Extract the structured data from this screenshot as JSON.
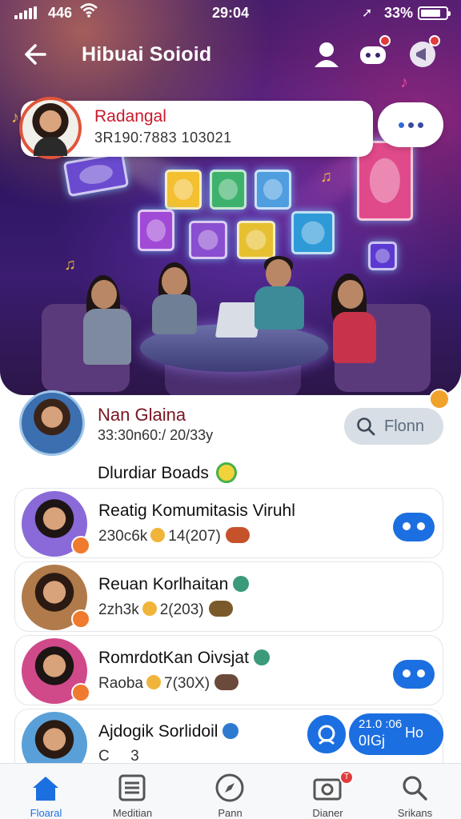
{
  "status_bar": {
    "network": "446",
    "time": "29:04",
    "battery_percent": "33%",
    "battery_level": 0.8
  },
  "header": {
    "title": "Hibuai Soioid",
    "icons": [
      "back-arrow-icon",
      "profile-icon",
      "chat-icon",
      "megaphone-icon"
    ]
  },
  "profile": {
    "name": "Radangal",
    "subtitle": "3R190:7883 103021"
  },
  "host": {
    "name": "Nan Glaina",
    "meta": "33:30n60:/ 20/33y",
    "join_label": "Flonn"
  },
  "section": {
    "title": "Dlurdiar Boads"
  },
  "items": [
    {
      "title": "Reatig Komumitasis Viruhl",
      "meta_left": "230c6k",
      "meta_right": "14(207)"
    },
    {
      "title": "Reuan Korlhaitan",
      "meta_left": "2zh3k",
      "meta_right": "2(203)"
    },
    {
      "title": "RomrdotKan Oivsjat",
      "meta_left": "Raoba",
      "meta_right": "7(30X)"
    },
    {
      "title": "Ajdogik Sorlidoil",
      "meta_left": "C",
      "meta_right": "3"
    }
  ],
  "floating": {
    "timer_line1": "21.0 :06",
    "timer_line2": "0IGj",
    "timer_line3": "Ho"
  },
  "bottom_nav": [
    {
      "label": "Floaral",
      "icon": "home-icon",
      "active": true
    },
    {
      "label": "Meditian",
      "icon": "list-icon",
      "active": false
    },
    {
      "label": "Pann",
      "icon": "compass-icon",
      "active": false
    },
    {
      "label": "Dianer",
      "icon": "camera-icon",
      "active": false,
      "badge": "T"
    },
    {
      "label": "Srikans",
      "icon": "search-icon",
      "active": false
    }
  ]
}
